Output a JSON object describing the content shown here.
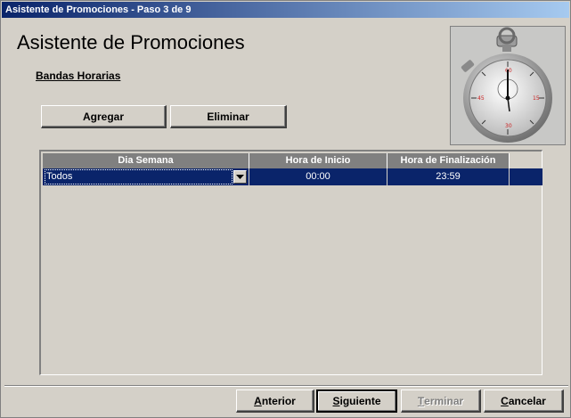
{
  "window": {
    "title": "Asistente de Promociones - Paso 3 de 9"
  },
  "header": {
    "title": "Asistente de Promociones",
    "section": "Bandas Horarias"
  },
  "toolbar": {
    "add_label": "Agregar",
    "delete_label": "Eliminar"
  },
  "grid": {
    "columns": [
      "Dia Semana",
      "Hora de Inicio",
      "Hora de Finalización"
    ],
    "rows": [
      {
        "day": "Todos",
        "start": "00:00",
        "end": "23:59",
        "selected": true
      }
    ]
  },
  "footer": {
    "prev_label": "Anterior",
    "prev_accel": "A",
    "next_label": "Siguiente",
    "next_accel": "S",
    "finish_label": "Terminar",
    "finish_accel": "T",
    "cancel_label": "Cancelar",
    "cancel_accel": "C"
  },
  "colors": {
    "title_bar": "#0a246a",
    "selection": "#0a246a",
    "header_bg": "#808080",
    "face": "#d4d0c8"
  },
  "image": {
    "icon": "stopwatch-icon"
  }
}
